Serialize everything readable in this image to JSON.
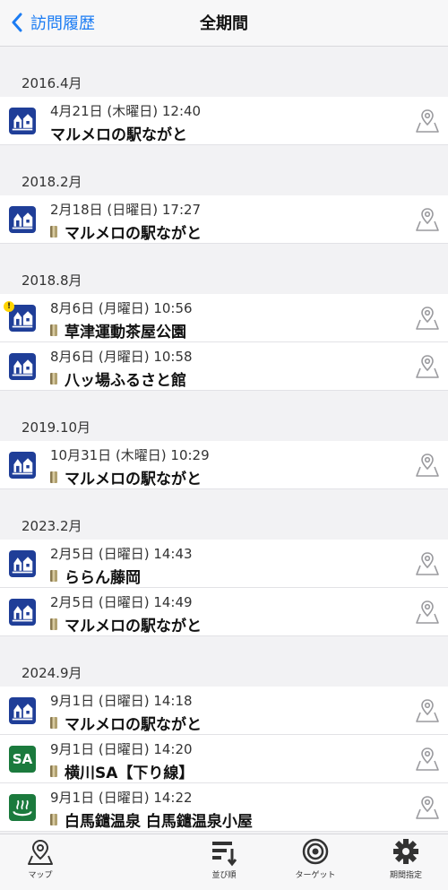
{
  "nav": {
    "back_label": "訪問履歴",
    "title": "全期間"
  },
  "colors": {
    "accent": "#1b7cf3",
    "michi_no_eki": "#1f3e98",
    "sa_green": "#1b7a3d",
    "warning": "#ffd400"
  },
  "sections": [
    {
      "header": "2016.4月",
      "items": [
        {
          "date": "4月21日 (木曜日) 12:40",
          "name": "マルメロの駅ながと",
          "icon": "michi-no-eki-icon",
          "stamp": false,
          "warning": false
        }
      ]
    },
    {
      "header": "2018.2月",
      "items": [
        {
          "date": "2月18日 (日曜日) 17:27",
          "name": "マルメロの駅ながと",
          "icon": "michi-no-eki-icon",
          "stamp": true,
          "warning": false
        }
      ]
    },
    {
      "header": "2018.8月",
      "items": [
        {
          "date": "8月6日 (月曜日) 10:56",
          "name": "草津運動茶屋公園",
          "icon": "michi-no-eki-icon",
          "stamp": true,
          "warning": true,
          "warning_mark": "!"
        },
        {
          "date": "8月6日 (月曜日) 10:58",
          "name": "八ッ場ふるさと館",
          "icon": "michi-no-eki-icon",
          "stamp": true,
          "warning": false
        }
      ]
    },
    {
      "header": "2019.10月",
      "items": [
        {
          "date": "10月31日 (木曜日) 10:29",
          "name": "マルメロの駅ながと",
          "icon": "michi-no-eki-icon",
          "stamp": true,
          "warning": false
        }
      ]
    },
    {
      "header": "2023.2月",
      "items": [
        {
          "date": "2月5日 (日曜日) 14:43",
          "name": "ららん藤岡",
          "icon": "michi-no-eki-icon",
          "stamp": true,
          "warning": false
        },
        {
          "date": "2月5日 (日曜日) 14:49",
          "name": "マルメロの駅ながと",
          "icon": "michi-no-eki-icon",
          "stamp": true,
          "warning": false
        }
      ]
    },
    {
      "header": "2024.9月",
      "items": [
        {
          "date": "9月1日 (日曜日) 14:18",
          "name": "マルメロの駅ながと",
          "icon": "michi-no-eki-icon",
          "stamp": true,
          "warning": false
        },
        {
          "date": "9月1日 (日曜日) 14:20",
          "name": "横川SA【下り線】",
          "icon": "sa-icon",
          "icon_text": "SA",
          "stamp": true,
          "warning": false
        },
        {
          "date": "9月1日 (日曜日) 14:22",
          "name": "白馬鑓温泉 白馬鑓温泉小屋",
          "icon": "onsen-icon",
          "stamp": true,
          "warning": false
        }
      ]
    }
  ],
  "tabs": [
    {
      "label": "マップ",
      "icon": "map-pin-icon"
    },
    {
      "label": "並び順",
      "icon": "sort-icon"
    },
    {
      "label": "ターゲット",
      "icon": "target-icon"
    },
    {
      "label": "期間指定",
      "icon": "gear-icon"
    }
  ]
}
